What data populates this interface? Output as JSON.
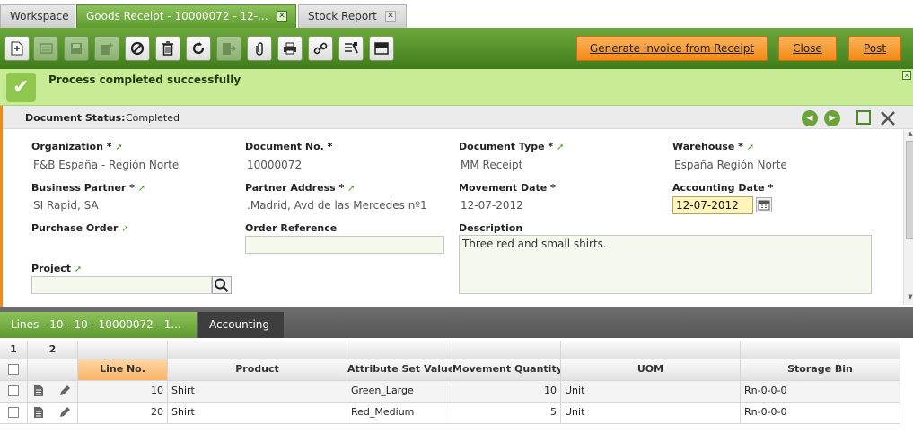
{
  "tabs": [
    {
      "label": "Workspace"
    },
    {
      "label": "Goods Receipt - 10000072 - 12-...",
      "active": true
    },
    {
      "label": "Stock Report"
    }
  ],
  "toolbar": {
    "icons": [
      "new-document-icon",
      "save-close-icon",
      "save-icon",
      "save-new-icon",
      "undo-icon",
      "delete-icon",
      "refresh-icon",
      "export-icon",
      "attachment-icon",
      "print-icon",
      "link-icon",
      "tree-icon",
      "toggle-grid-icon"
    ],
    "generate_invoice_label": "Generate Invoice from Receipt",
    "close_label": "Close",
    "post_label": "Post"
  },
  "message": {
    "text": "Process completed successfully"
  },
  "status": {
    "label": "Document Status:",
    "value": "Completed"
  },
  "form": {
    "organization": {
      "label": "Organization *",
      "value": "F&B España - Región Norte"
    },
    "document_no": {
      "label": "Document No. *",
      "value": "10000072"
    },
    "document_type": {
      "label": "Document Type *",
      "value": "MM Receipt"
    },
    "warehouse": {
      "label": "Warehouse *",
      "value": "España Región Norte"
    },
    "business_partner": {
      "label": "Business Partner *",
      "value": "SI Rapid, SA"
    },
    "partner_address": {
      "label": "Partner Address *",
      "value": ".Madrid, Avd de las Mercedes nº1"
    },
    "movement_date": {
      "label": "Movement Date *",
      "value": "12-07-2012"
    },
    "accounting_date": {
      "label": "Accounting Date *",
      "value": "12-07-2012"
    },
    "purchase_order": {
      "label": "Purchase Order",
      "value": ""
    },
    "order_reference": {
      "label": "Order Reference",
      "value": ""
    },
    "description": {
      "label": "Description",
      "value": "Three red and small shirts."
    },
    "project": {
      "label": "Project",
      "value": ""
    }
  },
  "lines_tabs": {
    "lines": "Lines - 10 - 10 - 10000072 - 1...",
    "accounting": "Accounting"
  },
  "grid": {
    "group_labels": [
      "1",
      "2"
    ],
    "columns": [
      "Line No.",
      "Product",
      "Attribute Set Value",
      "Movement Quantity",
      "UOM",
      "Storage Bin"
    ],
    "rows": [
      {
        "line_no": "10",
        "product": "Shirt",
        "attribute": "Green_Large",
        "quantity": "10",
        "uom": "Unit",
        "bin": "Rn-0-0-0"
      },
      {
        "line_no": "20",
        "product": "Shirt",
        "attribute": "Red_Medium",
        "quantity": "5",
        "uom": "Unit",
        "bin": "Rn-0-0-0"
      }
    ]
  },
  "colors": {
    "accent_green": "#5c9b2e",
    "accent_orange": "#f28a17",
    "message_bg": "#c8ec96"
  }
}
